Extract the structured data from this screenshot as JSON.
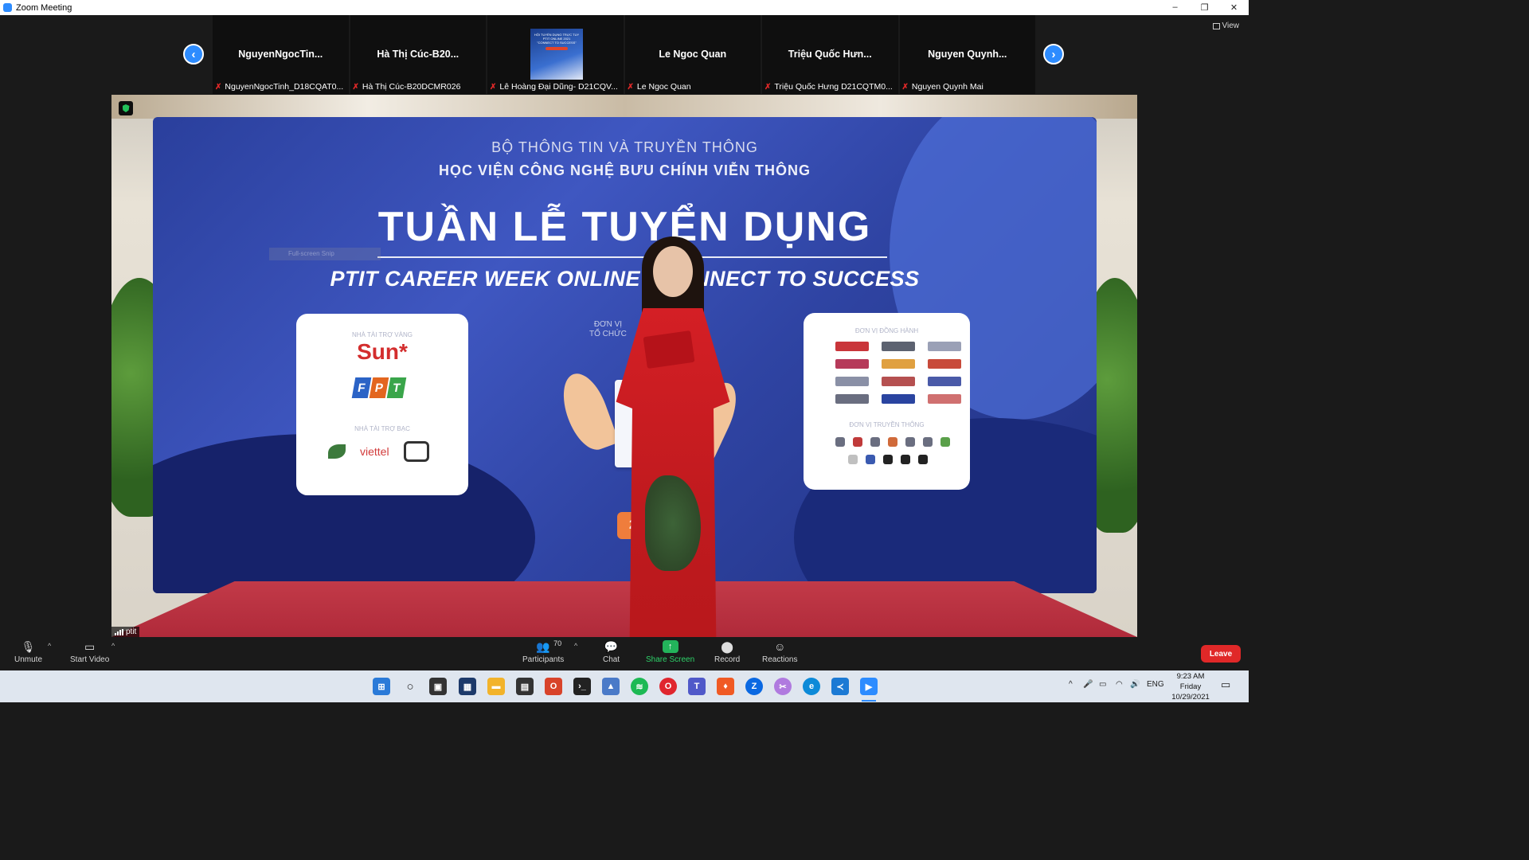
{
  "window": {
    "title": "Zoom Meeting",
    "controls": [
      "–",
      "❐",
      "✕"
    ]
  },
  "view_button": "View",
  "participants_strip": [
    {
      "big_name": "NguyenNgocTin...",
      "label": "NguyenNgocTinh_D18CQAT0..."
    },
    {
      "big_name": "Hà Thị Cúc-B20...",
      "label": "Hà Thị Cúc-B20DCMR026"
    },
    {
      "big_name": "",
      "label": "Lê Hoàng Đại Dũng- D21CQV...",
      "has_video": true,
      "thumb_text": [
        "HỘI TUYỂN DỤNG TRỰC TUY",
        "PTIT ONLINE 2021",
        "\"CONNECT TO SUCCESS\""
      ]
    },
    {
      "big_name": "Le Ngoc Quan",
      "label": "Le Ngoc Quan"
    },
    {
      "big_name": "Triệu Quốc Hưn...",
      "label": "Triệu Quốc Hưng D21CQTM0..."
    },
    {
      "big_name": "Nguyen  Quynh...",
      "label": "Nguyen Quynh Mai"
    }
  ],
  "main_video": {
    "speaker_label": "ptit",
    "snip_overlay": "Full-screen Snip",
    "banner": {
      "line1": "BỘ THÔNG TIN VÀ TRUYỀN THÔNG",
      "line2": "HỌC VIỆN CÔNG NGHỆ BƯU CHÍNH VIỄN THÔNG",
      "title": "TUẦN LỄ TUYỂN DỤNG",
      "subtitle": "PTIT CAREER WEEK ONLINE      - CONNECT TO SUCCESS",
      "left_card": {
        "caption_top": "NHÀ TÀI TRỢ VÀNG",
        "sun": "Sun*",
        "fpt": [
          "F",
          "P",
          "T"
        ],
        "caption_mid": "NHÀ TÀI TRỢ BẠC",
        "viettel": "viettel"
      },
      "organizer_caption": "ĐƠN VỊ\nTỔ CHỨC",
      "date": "25",
      "right_card": {
        "caption_top": "ĐƠN VỊ ĐỒNG HÀNH",
        "caption_mid": "ĐƠN VỊ TRUYỀN THÔNG"
      }
    }
  },
  "toolbar": {
    "unmute": "Unmute",
    "start_video": "Start Video",
    "participants": "Participants",
    "participants_count": "70",
    "chat": "Chat",
    "share_screen": "Share Screen",
    "record": "Record",
    "reactions": "Reactions",
    "leave": "Leave"
  },
  "taskbar": {
    "language": "ENG",
    "time": "9:23 AM",
    "day": "Friday",
    "date": "10/29/2021"
  },
  "colors": {
    "zoom_blue": "#2d8cff",
    "leave_red": "#e02828",
    "share_green": "#23b35b",
    "banner_blue": "#3f57c1",
    "dress_red": "#d41f25"
  }
}
